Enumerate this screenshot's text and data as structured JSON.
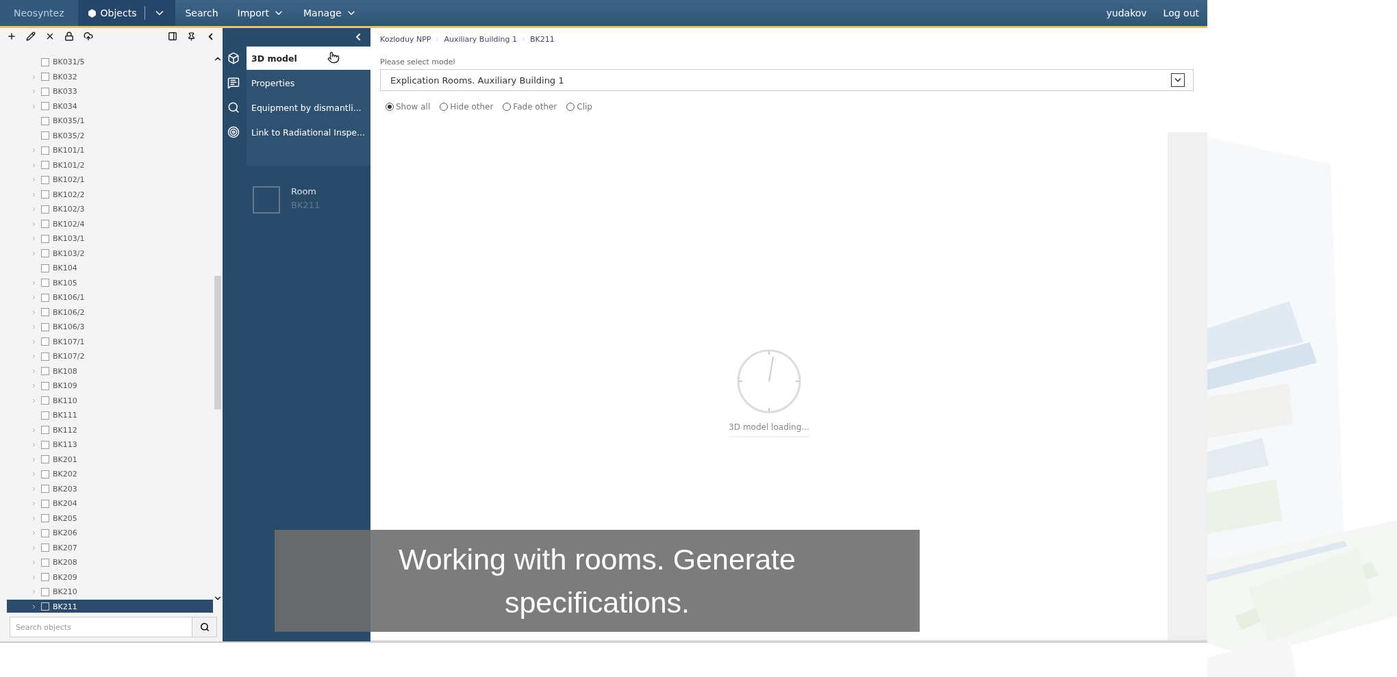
{
  "top_bar": {
    "brand": "Neosyntez",
    "menu": [
      {
        "label": "Objects",
        "selected": true,
        "kind": "split"
      },
      {
        "label": "Search",
        "selected": false,
        "kind": "plain"
      },
      {
        "label": "Import",
        "selected": false,
        "kind": "dropdown"
      },
      {
        "label": "Manage",
        "selected": false,
        "kind": "dropdown"
      }
    ],
    "user": "yudakov",
    "logout": "Log out"
  },
  "tree": {
    "items": [
      {
        "label": "BK031/5",
        "expandable": false,
        "checked": false,
        "selected": false
      },
      {
        "label": "BK032",
        "expandable": true,
        "checked": false,
        "selected": false
      },
      {
        "label": "BK033",
        "expandable": true,
        "checked": false,
        "selected": false
      },
      {
        "label": "BK034",
        "expandable": true,
        "checked": false,
        "selected": false
      },
      {
        "label": "BK035/1",
        "expandable": false,
        "checked": false,
        "selected": false
      },
      {
        "label": "BK035/2",
        "expandable": false,
        "checked": false,
        "selected": false
      },
      {
        "label": "BK101/1",
        "expandable": true,
        "checked": false,
        "selected": false
      },
      {
        "label": "BK101/2",
        "expandable": true,
        "checked": false,
        "selected": false
      },
      {
        "label": "BK102/1",
        "expandable": true,
        "checked": false,
        "selected": false
      },
      {
        "label": "BK102/2",
        "expandable": true,
        "checked": false,
        "selected": false
      },
      {
        "label": "BK102/3",
        "expandable": true,
        "checked": false,
        "selected": false
      },
      {
        "label": "BK102/4",
        "expandable": true,
        "checked": false,
        "selected": false
      },
      {
        "label": "BK103/1",
        "expandable": true,
        "checked": false,
        "selected": false
      },
      {
        "label": "BK103/2",
        "expandable": true,
        "checked": false,
        "selected": false
      },
      {
        "label": "BK104",
        "expandable": false,
        "checked": false,
        "selected": false
      },
      {
        "label": "BK105",
        "expandable": true,
        "checked": false,
        "selected": false
      },
      {
        "label": "BK106/1",
        "expandable": true,
        "checked": false,
        "selected": false
      },
      {
        "label": "BK106/2",
        "expandable": true,
        "checked": false,
        "selected": false
      },
      {
        "label": "BK106/3",
        "expandable": true,
        "checked": false,
        "selected": false
      },
      {
        "label": "BK107/1",
        "expandable": true,
        "checked": false,
        "selected": false
      },
      {
        "label": "BK107/2",
        "expandable": true,
        "checked": false,
        "selected": false
      },
      {
        "label": "BK108",
        "expandable": true,
        "checked": false,
        "selected": false
      },
      {
        "label": "BK109",
        "expandable": true,
        "checked": false,
        "selected": false
      },
      {
        "label": "BK110",
        "expandable": true,
        "checked": false,
        "selected": false
      },
      {
        "label": "BK111",
        "expandable": false,
        "checked": false,
        "selected": false
      },
      {
        "label": "BK112",
        "expandable": true,
        "checked": false,
        "selected": false
      },
      {
        "label": "BK113",
        "expandable": true,
        "checked": false,
        "selected": false
      },
      {
        "label": "BK201",
        "expandable": true,
        "checked": false,
        "selected": false
      },
      {
        "label": "BK202",
        "expandable": true,
        "checked": false,
        "selected": false
      },
      {
        "label": "BK203",
        "expandable": true,
        "checked": false,
        "selected": false
      },
      {
        "label": "BK204",
        "expandable": true,
        "checked": false,
        "selected": false
      },
      {
        "label": "BK205",
        "expandable": true,
        "checked": false,
        "selected": false
      },
      {
        "label": "BK206",
        "expandable": true,
        "checked": false,
        "selected": false
      },
      {
        "label": "BK207",
        "expandable": true,
        "checked": false,
        "selected": false
      },
      {
        "label": "BK208",
        "expandable": true,
        "checked": false,
        "selected": false
      },
      {
        "label": "BK209",
        "expandable": true,
        "checked": false,
        "selected": false
      },
      {
        "label": "BK210",
        "expandable": true,
        "checked": false,
        "selected": false
      },
      {
        "label": "BK211",
        "expandable": true,
        "checked": false,
        "selected": true
      }
    ],
    "search": {
      "placeholder": "Search objects"
    }
  },
  "side_menu": {
    "items": [
      {
        "label": "3D model",
        "selected": true
      },
      {
        "label": "Properties",
        "selected": false
      },
      {
        "label": "Equipment by dismantli...",
        "selected": false
      },
      {
        "label": "Link to Radiational Inspe...",
        "selected": false
      }
    ],
    "object": {
      "type": "Room",
      "name": "BK211"
    }
  },
  "breadcrumbs": [
    "Kozloduy NPP",
    "Auxiliary Building 1",
    "BK211"
  ],
  "model_select": {
    "label": "Please select model",
    "value": "Explication Rooms. Auxiliary Building 1"
  },
  "view_modes": [
    {
      "label": "Show all",
      "selected": true
    },
    {
      "label": "Hide other",
      "selected": false
    },
    {
      "label": "Fade other",
      "selected": false
    },
    {
      "label": "Clip",
      "selected": false
    }
  ],
  "viewer": {
    "status": "3D model loading..."
  },
  "caption": "Working with rooms. Generate specifications."
}
